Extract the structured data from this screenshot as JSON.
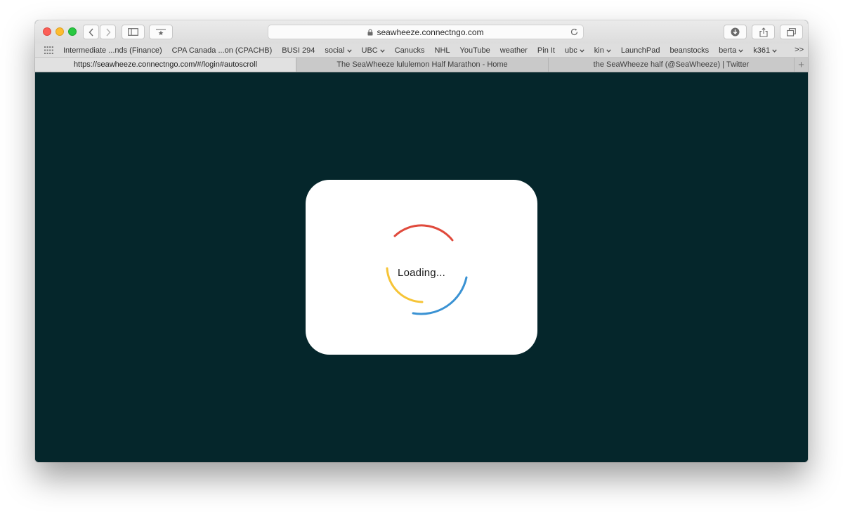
{
  "browser": {
    "url_domain": "seawheeze.connectngo.com",
    "bookmarks": [
      {
        "label": "Intermediate ...nds (Finance)",
        "dropdown": false
      },
      {
        "label": "CPA Canada ...on (CPACHB)",
        "dropdown": false
      },
      {
        "label": "BUSI 294",
        "dropdown": false
      },
      {
        "label": "social",
        "dropdown": true
      },
      {
        "label": "UBC",
        "dropdown": true
      },
      {
        "label": "Canucks",
        "dropdown": false
      },
      {
        "label": "NHL",
        "dropdown": false
      },
      {
        "label": "YouTube",
        "dropdown": false
      },
      {
        "label": "weather",
        "dropdown": false
      },
      {
        "label": "Pin It",
        "dropdown": false
      },
      {
        "label": "ubc",
        "dropdown": true
      },
      {
        "label": "kin",
        "dropdown": true
      },
      {
        "label": "LaunchPad",
        "dropdown": false
      },
      {
        "label": "beanstocks",
        "dropdown": false
      },
      {
        "label": "berta",
        "dropdown": true
      },
      {
        "label": "k361",
        "dropdown": true
      }
    ],
    "bookmarks_overflow": ">>",
    "tabs": [
      {
        "label": "https://seawheeze.connectngo.com/#/login#autoscroll",
        "active": true
      },
      {
        "label": "The SeaWheeze lululemon Half Marathon - Home",
        "active": false
      },
      {
        "label": "the SeaWheeze half (@SeaWheeze) | Twitter",
        "active": false
      }
    ]
  },
  "page": {
    "background_color": "#05262b",
    "loading_text": "Loading...",
    "spinner_colors": {
      "red": "#e04a3c",
      "yellow": "#f6c436",
      "blue": "#3a92d3"
    }
  }
}
